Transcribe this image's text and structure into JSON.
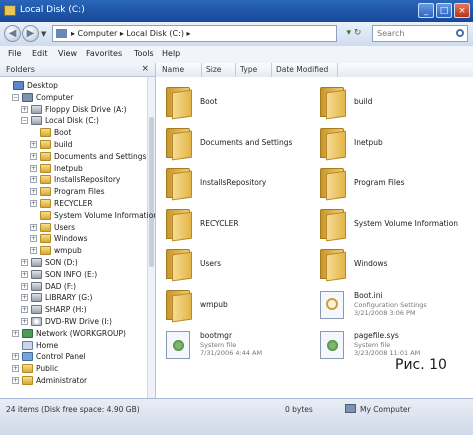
{
  "window": {
    "title": "Local Disk (C:)",
    "controls": {
      "minimize": "_",
      "maximize": "□",
      "close": "×"
    }
  },
  "address_bar": {
    "back_icon": "back-arrow-icon",
    "forward_icon": "forward-arrow-icon",
    "path": "▸ Computer ▸ Local Disk (C:) ▸",
    "refresh_label": "▾ ↻",
    "search_placeholder": "Search"
  },
  "menu": [
    "File",
    "Edit",
    "View",
    "Favorites",
    "Tools",
    "Help"
  ],
  "folders_pane": {
    "header": "Folders",
    "close_glyph": "×",
    "items": [
      {
        "label": "Desktop",
        "icon": "desktop",
        "level": 0,
        "expander": ""
      },
      {
        "label": "Computer",
        "icon": "computer",
        "level": 1,
        "expander": "−"
      },
      {
        "label": "Floppy Disk Drive (A:)",
        "icon": "drive",
        "level": 2,
        "expander": "+"
      },
      {
        "label": "Local Disk (C:)",
        "icon": "drive",
        "level": 2,
        "expander": "−"
      },
      {
        "label": "Boot",
        "icon": "folder",
        "level": 3,
        "expander": ""
      },
      {
        "label": "build",
        "icon": "folder",
        "level": 3,
        "expander": "+"
      },
      {
        "label": "Documents and Settings",
        "icon": "folder",
        "level": 3,
        "expander": "+"
      },
      {
        "label": "Inetpub",
        "icon": "folder",
        "level": 3,
        "expander": "+"
      },
      {
        "label": "InstallsRepository",
        "icon": "folder",
        "level": 3,
        "expander": "+"
      },
      {
        "label": "Program Files",
        "icon": "folder",
        "level": 3,
        "expander": "+"
      },
      {
        "label": "RECYCLER",
        "icon": "folder",
        "level": 3,
        "expander": "+"
      },
      {
        "label": "System Volume Information",
        "icon": "folder",
        "level": 3,
        "expander": ""
      },
      {
        "label": "Users",
        "icon": "folder",
        "level": 3,
        "expander": "+"
      },
      {
        "label": "Windows",
        "icon": "folder",
        "level": 3,
        "expander": "+"
      },
      {
        "label": "wmpub",
        "icon": "folder",
        "level": 3,
        "expander": "+"
      },
      {
        "label": "SON (D:)",
        "icon": "drive",
        "level": 2,
        "expander": "+"
      },
      {
        "label": "SON INFO (E:)",
        "icon": "drive",
        "level": 2,
        "expander": "+"
      },
      {
        "label": "DAD (F:)",
        "icon": "drive",
        "level": 2,
        "expander": "+"
      },
      {
        "label": "LIBRARY (G:)",
        "icon": "drive",
        "level": 2,
        "expander": "+"
      },
      {
        "label": "SHARP (H:)",
        "icon": "drive",
        "level": 2,
        "expander": "+"
      },
      {
        "label": "DVD-RW Drive (I:)",
        "icon": "cdrom",
        "level": 2,
        "expander": "+"
      },
      {
        "label": "Network (WORKGROUP)",
        "icon": "network",
        "level": 1,
        "expander": "+"
      },
      {
        "label": "Home",
        "icon": "home",
        "level": 1,
        "expander": ""
      },
      {
        "label": "Control Panel",
        "icon": "panel",
        "level": 1,
        "expander": "+"
      },
      {
        "label": "Public",
        "icon": "folder",
        "level": 1,
        "expander": "+"
      },
      {
        "label": "Administrator",
        "icon": "folder",
        "level": 1,
        "expander": "+"
      }
    ]
  },
  "columns": [
    "Name",
    "Size",
    "Type",
    "Date Modified"
  ],
  "files": [
    {
      "name": "Boot",
      "kind": "folder",
      "lines": []
    },
    {
      "name": "build",
      "kind": "folder",
      "lines": []
    },
    {
      "name": "Documents and Settings",
      "kind": "folder",
      "lines": []
    },
    {
      "name": "Inetpub",
      "kind": "folder",
      "lines": []
    },
    {
      "name": "InstallsRepository",
      "kind": "folder",
      "lines": []
    },
    {
      "name": "Program Files",
      "kind": "folder",
      "lines": []
    },
    {
      "name": "RECYCLER",
      "kind": "folder",
      "lines": []
    },
    {
      "name": "System Volume Information",
      "kind": "folder",
      "lines": []
    },
    {
      "name": "Users",
      "kind": "folder",
      "lines": []
    },
    {
      "name": "Windows",
      "kind": "folder",
      "lines": []
    },
    {
      "name": "wmpub",
      "kind": "folder",
      "lines": []
    },
    {
      "name": "Boot.ini",
      "kind": "config",
      "lines": [
        "Configuration Settings",
        "3/21/2008 3:06 PM"
      ]
    },
    {
      "name": "bootmgr",
      "kind": "system",
      "lines": [
        "System file",
        "7/31/2006 4:44 AM"
      ]
    },
    {
      "name": "pagefile.sys",
      "kind": "system",
      "lines": [
        "System file",
        "3/23/2008 11:01 AM"
      ]
    }
  ],
  "caption": "Рис. 10",
  "status": {
    "left": "24 items (Disk free space: 4.90 GB)",
    "middle": "0 bytes",
    "right": "My Computer"
  }
}
